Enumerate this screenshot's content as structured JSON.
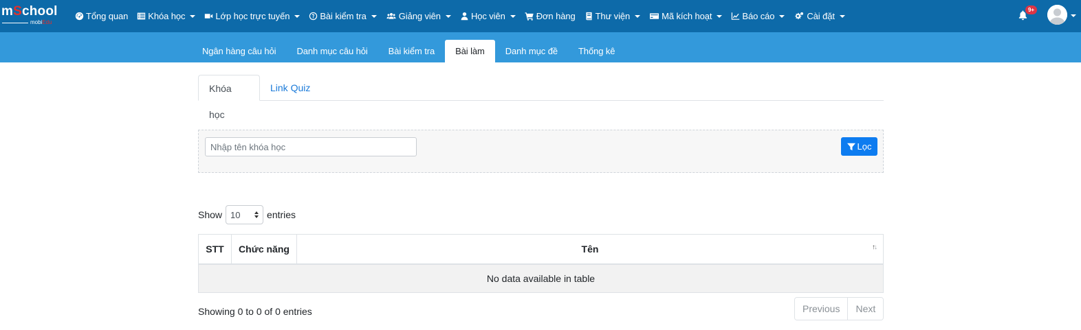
{
  "brand": {
    "name_prefix": "m",
    "name_accent": "S",
    "name_suffix": "chool",
    "sub_prefix": "mobi",
    "sub_accent": "Edu",
    "colors": {
      "primary": "#0d6aa9",
      "secondary": "#3399db",
      "accent": "#e5302a"
    }
  },
  "nav": {
    "items": [
      {
        "label": "Tổng quan",
        "icon": "dashboard-icon",
        "caret": false
      },
      {
        "label": "Khóa học",
        "icon": "list-icon",
        "caret": true
      },
      {
        "label": "Lớp học trực tuyến",
        "icon": "video-icon",
        "caret": true
      },
      {
        "label": "Bài kiểm tra",
        "icon": "question-circle-icon",
        "caret": true
      },
      {
        "label": "Giảng viên",
        "icon": "users-icon",
        "caret": true
      },
      {
        "label": "Học viên",
        "icon": "user-icon",
        "caret": true
      },
      {
        "label": "Đơn hàng",
        "icon": "cart-icon",
        "caret": false
      },
      {
        "label": "Thư viện",
        "icon": "book-icon",
        "caret": true
      },
      {
        "label": "Mã kích hoạt",
        "icon": "credit-card-icon",
        "caret": true
      },
      {
        "label": "Báo cáo",
        "icon": "line-chart-icon",
        "caret": true
      },
      {
        "label": "Cài đặt",
        "icon": "cogs-icon",
        "caret": true
      }
    ],
    "notification_count": "9+"
  },
  "subnav": {
    "tabs": [
      "Ngân hàng câu hỏi",
      "Danh mục câu hỏi",
      "Bài kiểm tra",
      "Bài làm",
      "Danh mục đề",
      "Thống kê"
    ],
    "active": "Bài làm"
  },
  "content_tabs": {
    "course": "Khóa học",
    "quiz_link": "Link Quiz"
  },
  "filter": {
    "placeholder": "Nhập tên khóa học",
    "button": "Lọc"
  },
  "table": {
    "show_label": "Show",
    "entries_label": "entries",
    "page_size": "10",
    "columns": [
      "STT",
      "Chức năng",
      "Tên"
    ],
    "empty_message": "No data available in table",
    "info": "Showing 0 to 0 of 0 entries",
    "prev": "Previous",
    "next": "Next"
  }
}
